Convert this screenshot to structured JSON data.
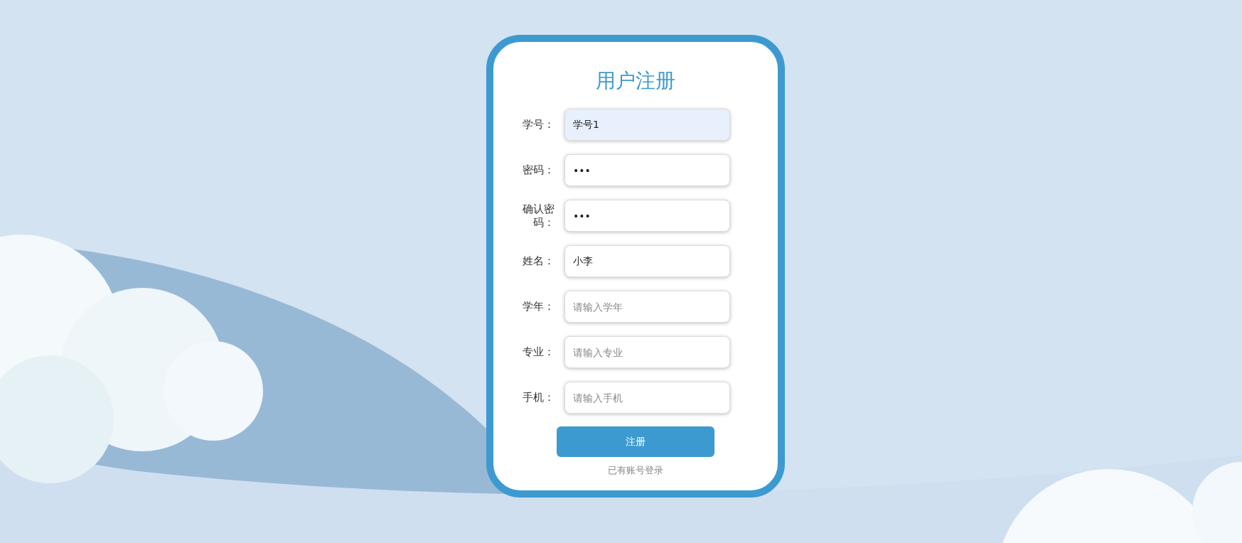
{
  "title": "用户注册",
  "fields": [
    {
      "label": "学号：",
      "value": "学号1",
      "autofilled": true
    },
    {
      "label": "密码：",
      "value": "•••",
      "autofilled": false
    },
    {
      "label": "确认密码：",
      "value": "•••",
      "autofilled": false
    },
    {
      "label": "姓名：",
      "value": "小李",
      "autofilled": false
    },
    {
      "label": "学年：",
      "placeholder": "请输入学年",
      "autofilled": false
    },
    {
      "label": "专业：",
      "placeholder": "请输入专业",
      "autofilled": false
    },
    {
      "label": "手机：",
      "placeholder": "请输入手机",
      "autofilled": false
    }
  ],
  "submit_button": "注册",
  "login_link": "已有账号登录"
}
